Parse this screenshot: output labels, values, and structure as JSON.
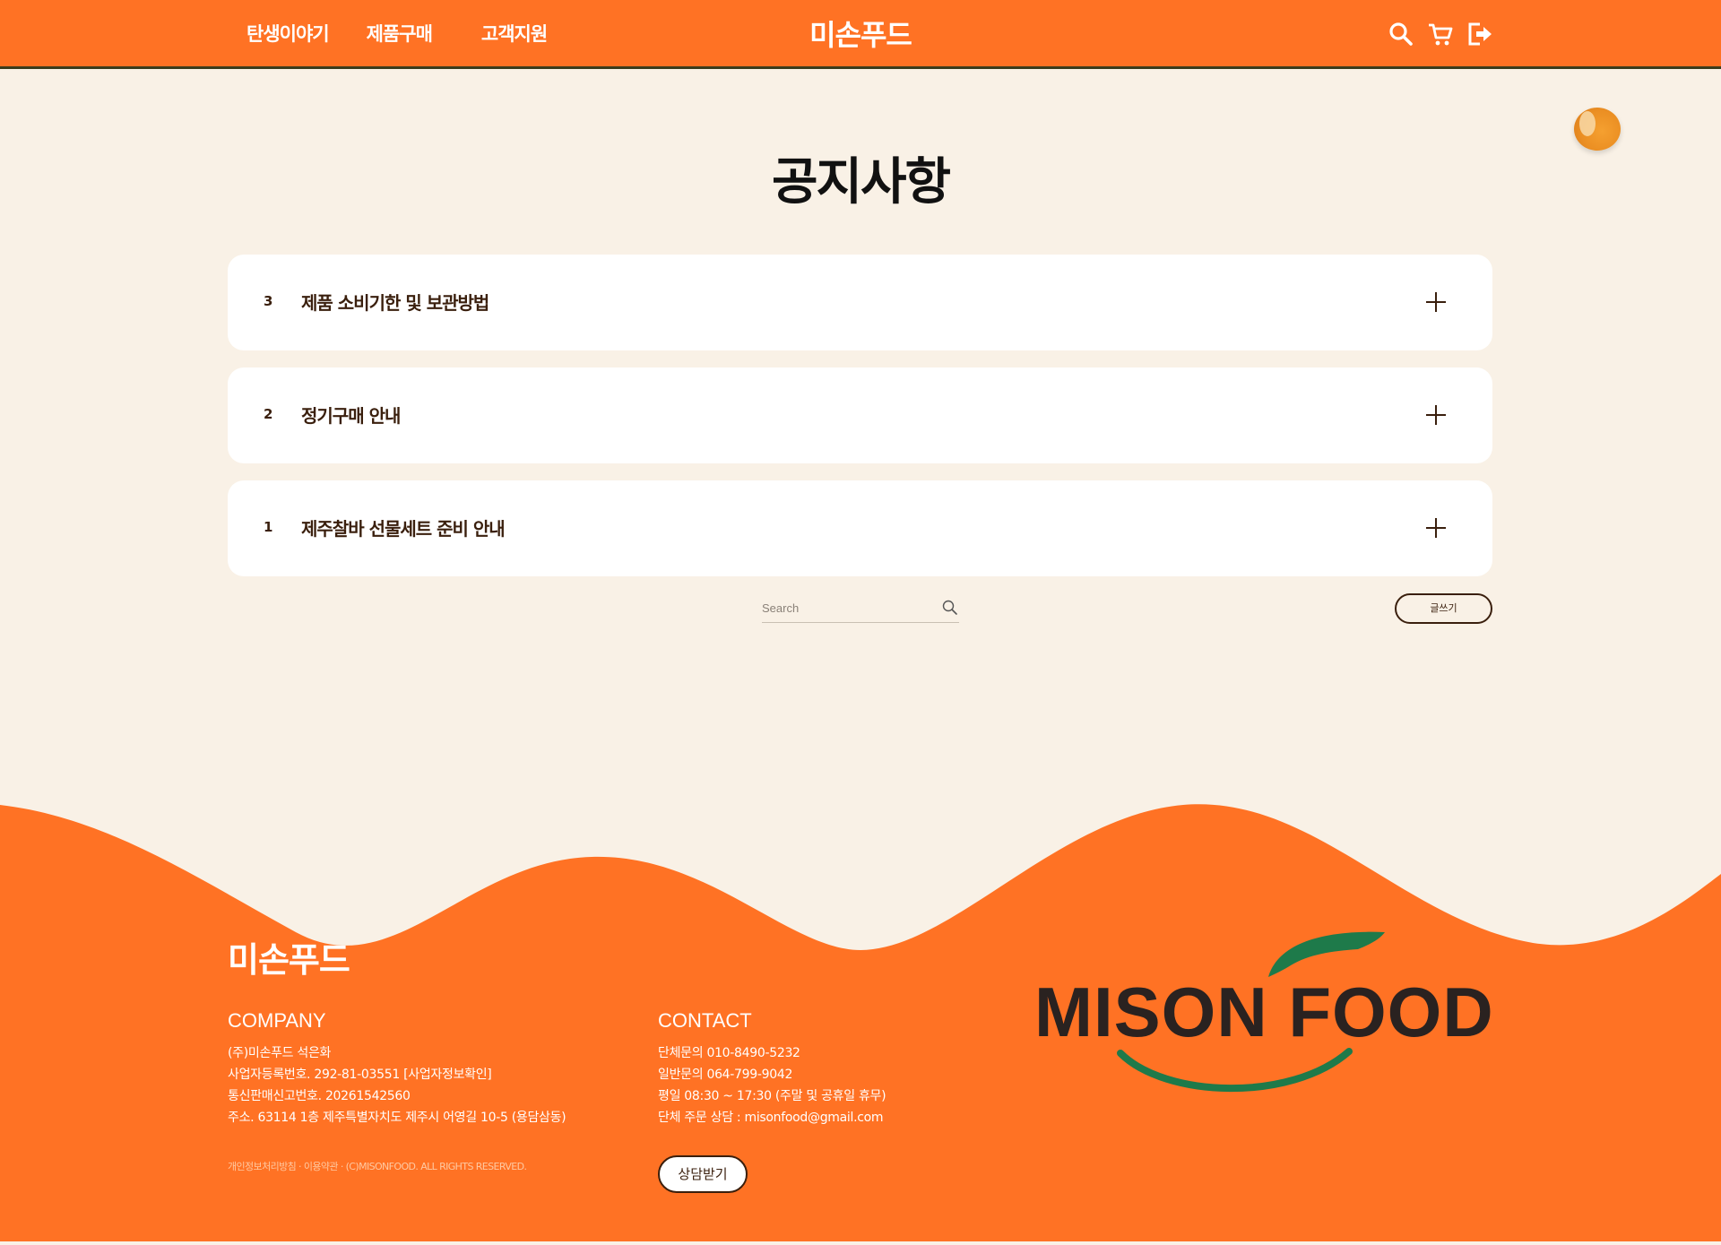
{
  "header": {
    "nav": [
      "탄생이야기",
      "제품구매",
      "고객지원"
    ],
    "logo": "미손푸드",
    "icons": [
      "search-icon",
      "cart-icon",
      "logout-icon"
    ]
  },
  "main": {
    "title": "공지사항",
    "notices": [
      {
        "num": "3",
        "title": "제품 소비기한 및 보관방법"
      },
      {
        "num": "2",
        "title": "정기구매 안내"
      },
      {
        "num": "1",
        "title": "제주찰바 선물세트 준비 안내"
      }
    ],
    "search_placeholder": "Search",
    "write_label": "글쓰기"
  },
  "footer": {
    "logo": "미손푸드",
    "company_title": "COMPANY",
    "company_lines": [
      "(주)미손푸드   석은화",
      "사업자등록번호. 292-81-03551 [사업자정보확인]",
      "통신판매신고번호. 20261542560",
      "주소. 63114 1층 제주특별자치도 제주시 어영길 10-5 (용담삼동)"
    ],
    "contact_title": "CONTACT",
    "contact_lines": [
      "단체문의 010-8490-5232",
      "일반문의 064-799-9042",
      "평일 08:30 ~ 17:30 (주말 및 공휴일 휴무)",
      "단체 주문 상담 : misonfood@gmail.com"
    ],
    "copyright": "개인정보처리방침 · 이용약관 · (C)MISONFOOD. ALL RIGHTS RESERVED.",
    "consult_label": "상담받기",
    "brand_text": "MISON FOOD"
  },
  "colors": {
    "brand_orange": "#ff7224",
    "background": "#f9f1e6",
    "text_brown": "#3a1f0d",
    "logo_green": "#1e7a4a"
  }
}
